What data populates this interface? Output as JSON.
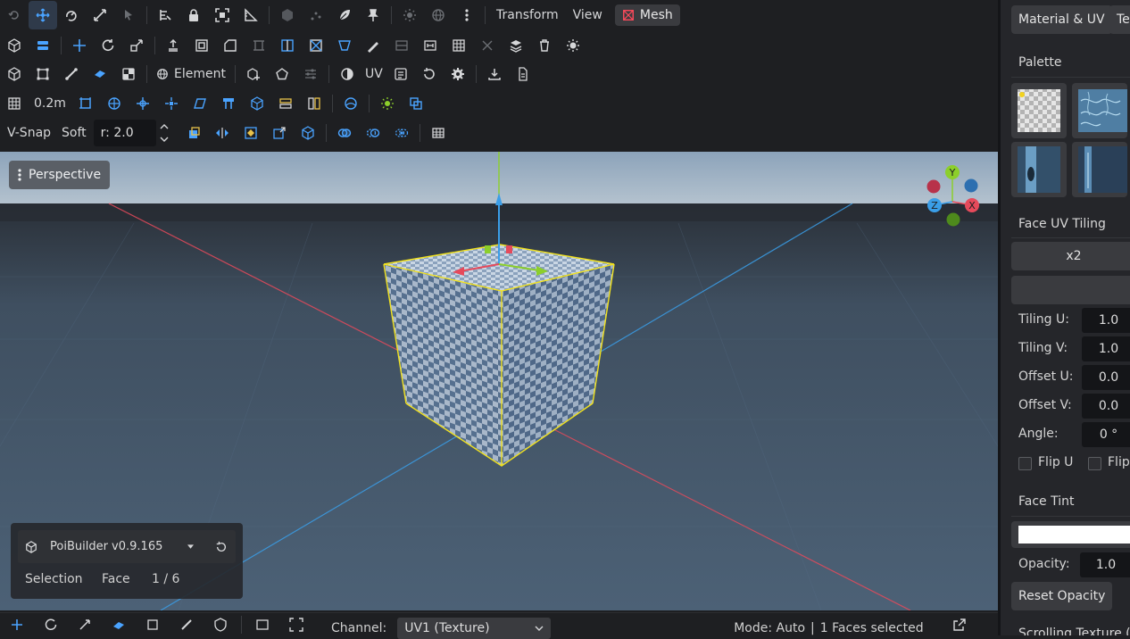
{
  "toolbar": {
    "transform_menu": "Transform",
    "view_menu": "View",
    "mesh_label": "Mesh",
    "element_label": "Element",
    "uv_label": "UV",
    "grid_size": "0.2m",
    "vsnap_label": "V-Snap",
    "soft_label": "Soft",
    "radius_value": "r: 2.0"
  },
  "viewport": {
    "view_mode": "Perspective",
    "gizmo_axes": {
      "y": "Y",
      "z": "Z",
      "x": "X"
    },
    "colors": {
      "x_axis": "#e64a5b",
      "y_axis": "#8ccf2b",
      "z_axis": "#3a9ee8",
      "selection": "#f2e21f"
    }
  },
  "info_panel": {
    "version": "PoiBuilder v0.9.165",
    "selection_label": "Selection",
    "mode_label": "Face",
    "count": "1 / 6"
  },
  "status_bar": {
    "channel_label": "Channel:",
    "channel_value": "UV1 (Texture)",
    "mode_text": "Mode: Auto",
    "selected_text": "1 Faces selected"
  },
  "right_panel": {
    "tabs": [
      "Material & UV",
      "Te"
    ],
    "palette_title": "Palette",
    "face_uv_title": "Face UV Tiling",
    "tile_x2": "x2",
    "props": [
      {
        "label": "Tiling U:",
        "value": "1.0"
      },
      {
        "label": "Tiling V:",
        "value": "1.0"
      },
      {
        "label": "Offset U:",
        "value": "0.0"
      },
      {
        "label": "Offset V:",
        "value": "0.0"
      },
      {
        "label": "Angle:",
        "value": "0 °"
      }
    ],
    "flip_u": "Flip U",
    "flip_v": "Flip",
    "face_tint_title": "Face Tint",
    "tint_color": "#ffffff",
    "opacity_label": "Opacity:",
    "opacity_value": "1.0",
    "reset_opacity": "Reset Opacity",
    "bottom_cut_text": "Scrolling Texture (f"
  }
}
